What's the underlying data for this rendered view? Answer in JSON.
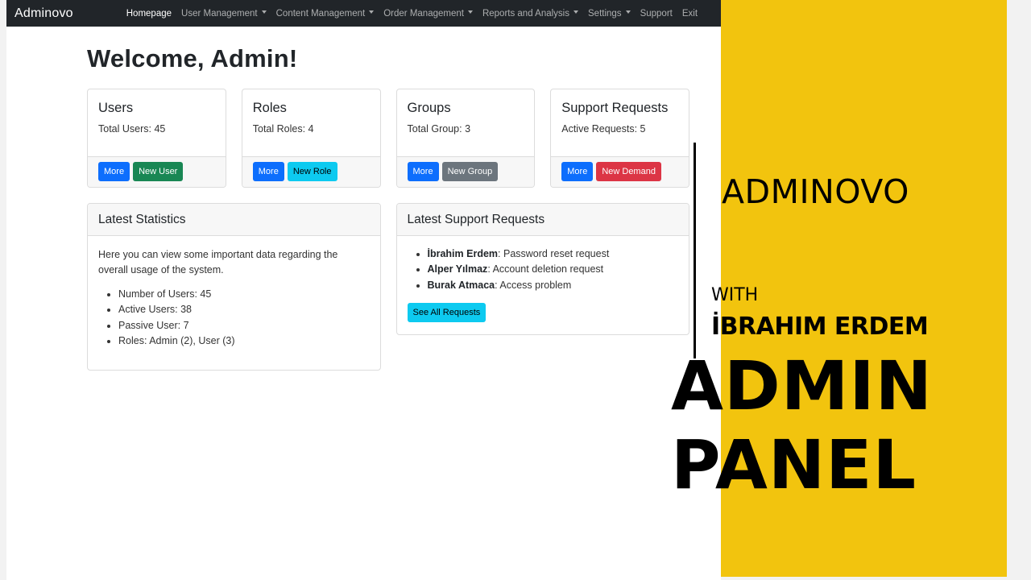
{
  "navbar": {
    "brand": "Adminovo",
    "items": [
      {
        "label": "Homepage",
        "active": true,
        "dropdown": false
      },
      {
        "label": "User Management",
        "active": false,
        "dropdown": true
      },
      {
        "label": "Content Management",
        "active": false,
        "dropdown": true
      },
      {
        "label": "Order Management",
        "active": false,
        "dropdown": true
      },
      {
        "label": "Reports and Analysis",
        "active": false,
        "dropdown": true
      },
      {
        "label": "Settings",
        "active": false,
        "dropdown": true
      },
      {
        "label": "Support",
        "active": false,
        "dropdown": false
      },
      {
        "label": "Exit",
        "active": false,
        "dropdown": false
      }
    ]
  },
  "page": {
    "title": "Welcome, Admin!"
  },
  "cards": [
    {
      "title": "Users",
      "text": "Total Users: 45",
      "more_label": "More",
      "action_label": "New User",
      "action_color": "#198754"
    },
    {
      "title": "Roles",
      "text": "Total Roles: 4",
      "more_label": "More",
      "action_label": "New Role",
      "action_color": "#0dcaf0"
    },
    {
      "title": "Groups",
      "text": "Total Group: 3",
      "more_label": "More",
      "action_label": "New Group",
      "action_color": "#6c757d"
    },
    {
      "title": "Support Requests",
      "text": "Active Requests: 5",
      "more_label": "More",
      "action_label": "New Demand",
      "action_color": "#dc3545"
    }
  ],
  "statistics": {
    "header": "Latest Statistics",
    "description": "Here you can view some important data regarding the overall usage of the system.",
    "items": [
      "Number of Users: 45",
      "Active Users: 38",
      "Passive User: 7",
      "Roles: Admin (2), User (3)"
    ]
  },
  "support": {
    "header": "Latest Support Requests",
    "requests": [
      {
        "name": "İbrahim Erdem",
        "issue": ": Password reset request"
      },
      {
        "name": "Alper Yılmaz",
        "issue": ": Account deletion request"
      },
      {
        "name": "Burak Atmaca",
        "issue": ": Access problem"
      }
    ],
    "see_all_label": "See All Requests"
  },
  "promo": {
    "line1": "ADMINOVO",
    "line2": "WITH",
    "line3": "İBRAHIM ERDEM",
    "line4": "ADMIN",
    "line5": "PANEL",
    "accent_color": "#f2c40e"
  }
}
